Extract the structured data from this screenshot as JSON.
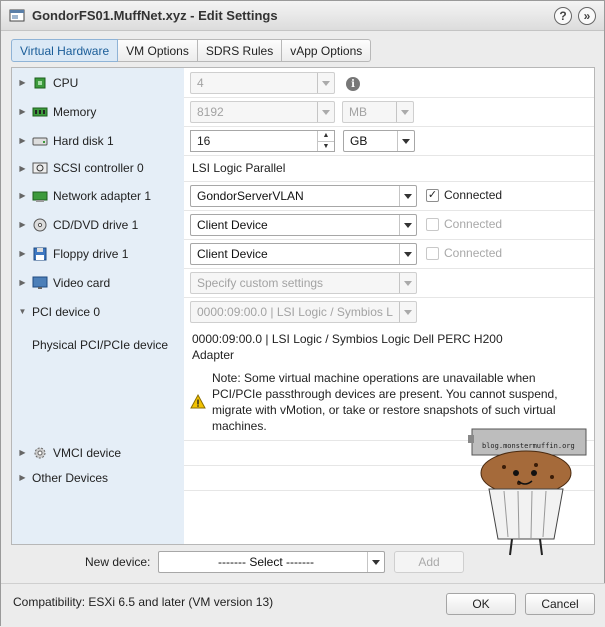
{
  "window": {
    "title": "GondorFS01.MuffNet.xyz - Edit Settings",
    "help_label": "?",
    "collapse_label": "»"
  },
  "tabs": [
    {
      "label": "Virtual Hardware",
      "active": true
    },
    {
      "label": "VM Options",
      "active": false
    },
    {
      "label": "SDRS Rules",
      "active": false
    },
    {
      "label": "vApp Options",
      "active": false
    }
  ],
  "hardware": {
    "cpu": {
      "label": "CPU",
      "value": "4",
      "info_icon": "i"
    },
    "memory": {
      "label": "Memory",
      "value": "8192",
      "unit": "MB"
    },
    "hard_disk": {
      "label": "Hard disk 1",
      "value": "16",
      "unit": "GB"
    },
    "scsi": {
      "label": "SCSI controller 0",
      "value": "LSI Logic Parallel"
    },
    "network": {
      "label": "Network adapter 1",
      "value": "GondorServerVLAN",
      "connected_label": "Connected",
      "connected": true
    },
    "cdrom": {
      "label": "CD/DVD drive 1",
      "value": "Client Device",
      "connected_label": "Connected",
      "connected": false
    },
    "floppy": {
      "label": "Floppy drive 1",
      "value": "Client Device",
      "connected_label": "Connected",
      "connected": false
    },
    "video": {
      "label": "Video card",
      "value": "Specify custom settings"
    },
    "pci": {
      "label": "PCI device 0",
      "value": "0000:09:00.0 | LSI Logic / Symbios L",
      "physical_label": "Physical PCI/PCIe device",
      "physical_value": "0000:09:00.0 | LSI Logic / Symbios Logic Dell PERC H200 Adapter",
      "note": "Note: Some virtual machine operations are unavailable when PCI/PCIe passthrough devices are present. You cannot suspend, migrate with vMotion, or take or restore snapshots of such virtual machines."
    },
    "vmci": {
      "label": "VMCI device"
    },
    "other": {
      "label": "Other Devices"
    }
  },
  "new_device": {
    "label": "New device:",
    "select_value": "------- Select -------",
    "add_label": "Add"
  },
  "footer": {
    "compatibility": "Compatibility: ESXi 6.5 and later (VM version 13)",
    "ok_label": "OK",
    "cancel_label": "Cancel"
  },
  "watermark": {
    "text": "blog.monstermuffin.org"
  },
  "icons": {
    "expand": "triangle-right-icon",
    "collapse": "triangle-down-icon",
    "warning": "warning-icon"
  },
  "colors": {
    "accent": "#1a5d98",
    "active_tab_bg": "#dbe9f6",
    "label_column_bg": "#e5eef7"
  }
}
